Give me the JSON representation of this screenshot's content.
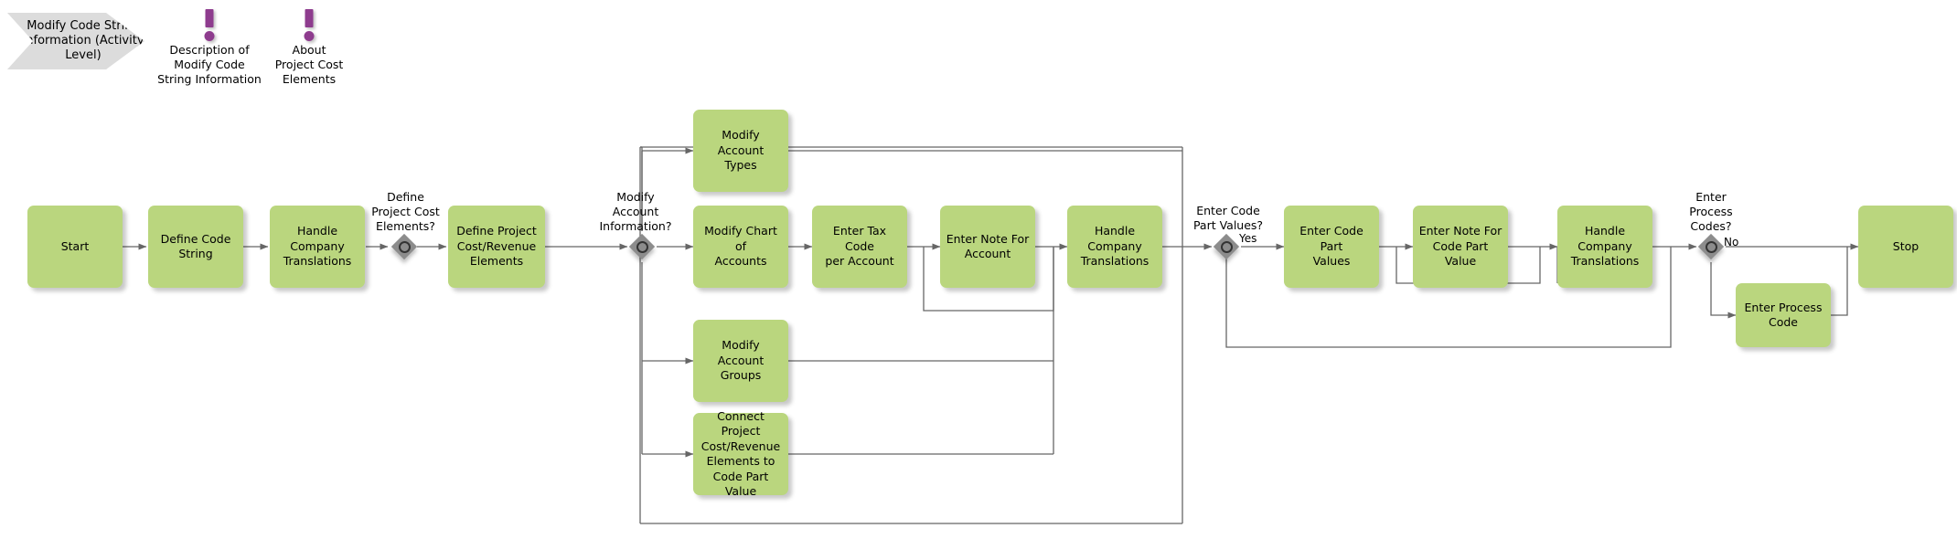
{
  "diagram": {
    "type": "bpmn-activity-flow",
    "title_block": {
      "text": "Modify Code\nString\nInformation\n(Activity Level)",
      "shape": "chevron",
      "fill": "#dcdcdc"
    },
    "colors": {
      "task_fill": "#bad67e",
      "gateway_fill": "#8c8c8c",
      "gateway_ring": "#333333",
      "note_marker": "#8e3c8e",
      "title_fill": "#dcdcdc",
      "connector": "#666666",
      "text": "#000000"
    },
    "notes": [
      {
        "id": "note-description",
        "label": "Description of\nModify Code\nString Information",
        "marker": "exclamation-icon"
      },
      {
        "id": "note-about",
        "label": "About\nProject Cost\nElements",
        "marker": "exclamation-icon"
      }
    ],
    "tasks": [
      {
        "id": "start",
        "label": "Start"
      },
      {
        "id": "define-code-string",
        "label": "Define Code\nString"
      },
      {
        "id": "handle-company-translations-1",
        "label": "Handle\nCompany\nTranslations"
      },
      {
        "id": "define-project-cost-revenue-elements",
        "label": "Define Project\nCost/Revenue\nElements"
      },
      {
        "id": "modify-account-types",
        "label": "Modify Account\nTypes"
      },
      {
        "id": "modify-chart-of-accounts",
        "label": "Modify Chart of\nAccounts"
      },
      {
        "id": "enter-tax-code-per-account",
        "label": "Enter Tax Code\nper Account"
      },
      {
        "id": "enter-note-for-account",
        "label": "Enter Note For\nAccount"
      },
      {
        "id": "handle-company-translations-2",
        "label": "Handle\nCompany\nTranslations"
      },
      {
        "id": "modify-account-groups",
        "label": "Modify Account\nGroups"
      },
      {
        "id": "connect-project-cost-revenue-elements",
        "label": "Connect Project\nCost/Revenue\nElements to\nCode Part\nValue"
      },
      {
        "id": "enter-code-part-values",
        "label": "Enter Code Part\nValues"
      },
      {
        "id": "enter-note-for-code-part-value",
        "label": "Enter Note For\nCode Part Value"
      },
      {
        "id": "handle-company-translations-3",
        "label": "Handle\nCompany\nTranslations"
      },
      {
        "id": "enter-process-code",
        "label": "Enter Process\nCode"
      },
      {
        "id": "stop",
        "label": "Stop"
      }
    ],
    "gateways": [
      {
        "id": "gw-define-project-cost-elements",
        "question": "Define\nProject Cost\nElements?",
        "branch_labels": []
      },
      {
        "id": "gw-modify-account-information",
        "question": "Modify\nAccount\nInformation?",
        "branch_labels": []
      },
      {
        "id": "gw-enter-code-part-values",
        "question": "Enter Code\nPart Values?",
        "branch_labels": [
          "Yes"
        ]
      },
      {
        "id": "gw-enter-process-codes",
        "question": "Enter\nProcess\nCodes?",
        "branch_labels": [
          "No"
        ]
      }
    ],
    "edge_labels": [
      {
        "id": "edge-label-yes",
        "text": "Yes"
      },
      {
        "id": "edge-label-no",
        "text": "No"
      }
    ]
  }
}
